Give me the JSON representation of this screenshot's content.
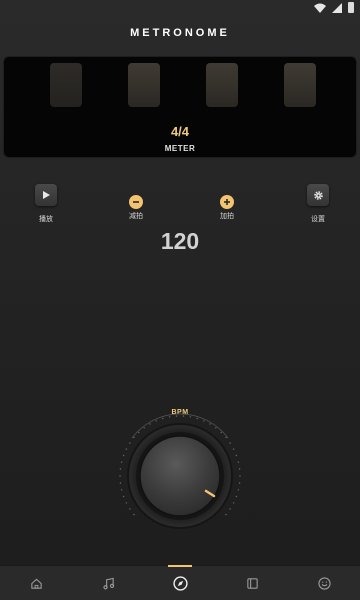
{
  "app": {
    "title": "METRONOME"
  },
  "meter": {
    "value": "4/4",
    "label": "METER",
    "beats": 4
  },
  "controls": {
    "play_label": "播放",
    "decrease_label": "减拍",
    "increase_label": "加拍",
    "settings_label": "设置"
  },
  "tempo": {
    "bpm": "120",
    "dial_label": "BPM"
  },
  "nav": {
    "items": [
      {
        "name": "home",
        "icon": "home-icon"
      },
      {
        "name": "music",
        "icon": "music-note-icon"
      },
      {
        "name": "metronome",
        "icon": "compass-icon",
        "active": true
      },
      {
        "name": "book",
        "icon": "book-icon"
      },
      {
        "name": "profile",
        "icon": "smile-icon"
      }
    ]
  },
  "colors": {
    "accent": "#f3c372",
    "background": "#242424",
    "panel": "#050505",
    "beat": "#3a3631"
  },
  "icons": {
    "play": "play-icon",
    "settings": "gear-icon",
    "minus": "minus-circle-icon",
    "plus": "plus-circle-icon"
  }
}
